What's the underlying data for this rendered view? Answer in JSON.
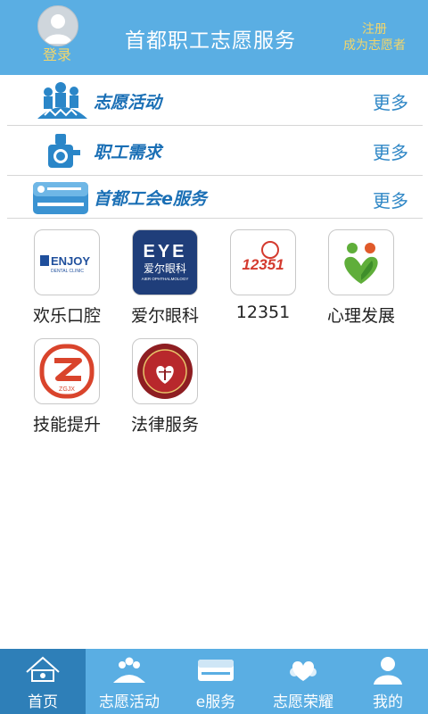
{
  "header": {
    "login_label": "登录",
    "title": "首都职工志愿服务",
    "register_line1": "注册",
    "register_line2": "成为志愿者"
  },
  "sections": [
    {
      "title": "志愿活动",
      "more": "更多",
      "icon": "volunteer-crowd-icon"
    },
    {
      "title": "职工需求",
      "more": "更多",
      "icon": "worker-demand-icon"
    },
    {
      "title": "首都工会e服务",
      "more": "更多",
      "icon": "union-card-icon"
    }
  ],
  "services": [
    {
      "label": "欢乐口腔",
      "logo_text": "ENJOY",
      "logo_sub": "DENTAL CLINIC"
    },
    {
      "label": "爱尔眼科",
      "logo_text": "EYE",
      "logo_cn": "爱尔眼科",
      "logo_sub": "AIER OPHTHALMOLOGY"
    },
    {
      "label": "12351",
      "logo_text": "12351"
    },
    {
      "label": "心理发展",
      "logo_text": ""
    },
    {
      "label": "技能提升",
      "logo_text": "ZGJX"
    },
    {
      "label": "法律服务",
      "logo_text": ""
    }
  ],
  "bottom_nav": [
    {
      "label": "首页",
      "icon": "home-icon",
      "active": true
    },
    {
      "label": "志愿活动",
      "icon": "volunteer-icon",
      "active": false
    },
    {
      "label": "e服务",
      "icon": "card-icon",
      "active": false
    },
    {
      "label": "志愿荣耀",
      "icon": "honor-icon",
      "active": false
    },
    {
      "label": "我的",
      "icon": "user-icon",
      "active": false
    }
  ],
  "colors": {
    "primary": "#5aaee3",
    "active_tab": "#2e7fb8",
    "accent_text": "#f4d66a",
    "link": "#2f87c6"
  }
}
